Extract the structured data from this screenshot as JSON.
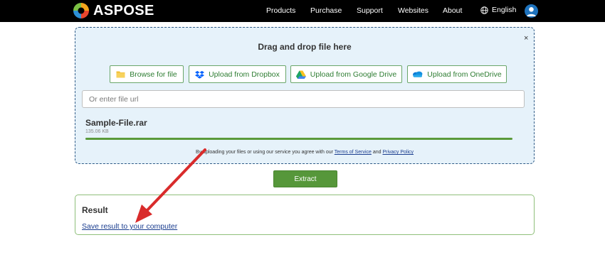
{
  "header": {
    "brand": "ASPOSE",
    "nav": [
      "Products",
      "Purchase",
      "Support",
      "Websites",
      "About"
    ],
    "language": "English",
    "icons": {
      "logo": "aspose-logo-icon",
      "language": "globe-icon",
      "account": "user-avatar-icon"
    }
  },
  "upload": {
    "title": "Drag and drop file here",
    "close_label": "×",
    "sources": [
      {
        "label": "Browse for file",
        "icon": "folder-icon"
      },
      {
        "label": "Upload from Dropbox",
        "icon": "dropbox-icon"
      },
      {
        "label": "Upload from Google Drive",
        "icon": "google-drive-icon"
      },
      {
        "label": "Upload from OneDrive",
        "icon": "onedrive-icon"
      }
    ],
    "url_placeholder": "Or enter file url",
    "file": {
      "name": "Sample-File.rar",
      "size": "135.06 KB",
      "progress": 1.0
    },
    "terms": {
      "prefix": "By uploading your files or using our service you agree with our",
      "tos": "Terms of Service",
      "and": "and",
      "privacy": "Privacy Policy"
    }
  },
  "extract_label": "Extract",
  "result": {
    "title": "Result",
    "link": "Save result to your computer"
  },
  "colors": {
    "header_bg": "#000000",
    "panel_bg": "#e6f2fa",
    "panel_border": "#2f5b87",
    "accent_green": "#56973a",
    "link_blue": "#1a3d8f",
    "arrow_red": "#d92b2b"
  }
}
